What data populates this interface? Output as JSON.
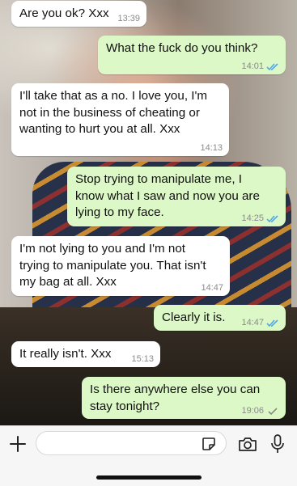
{
  "messages": [
    {
      "direction": "in",
      "text": "Are you ok? Xxx",
      "time": "13:39"
    },
    {
      "direction": "out",
      "text": "What the fuck do you think?",
      "time": "14:01",
      "status": "read"
    },
    {
      "direction": "in",
      "text": "I'll take that as a no. I love you, I'm\nnot in the business of cheating or\nwanting to hurt you at all. Xxx",
      "time": "14:13"
    },
    {
      "direction": "out",
      "text": "Stop trying to manipulate me, I\nknow what I saw and now you are\nlying to my face.",
      "time": "14:25",
      "status": "read"
    },
    {
      "direction": "in",
      "text": "I'm not lying to you and I'm not\ntrying to manipulate you. That isn't\nmy bag at all. Xxx",
      "time": "14:47"
    },
    {
      "direction": "out",
      "text": "Clearly it is.",
      "time": "14:47",
      "status": "read"
    },
    {
      "direction": "in",
      "text": "It really isn't. Xxx",
      "time": "15:13"
    },
    {
      "direction": "out",
      "text": "Is there anywhere else you can\nstay tonight?",
      "time": "19:06",
      "status": "delivered"
    }
  ],
  "composer": {
    "placeholder": "",
    "icons": [
      "plus-icon",
      "sticker-icon",
      "camera-icon",
      "microphone-icon"
    ]
  },
  "colors": {
    "incoming_bubble": "#ffffff",
    "outgoing_bubble": "#dcf8c6",
    "read_tick": "#4fa8e8",
    "delivered_tick": "#8a8a8a"
  }
}
